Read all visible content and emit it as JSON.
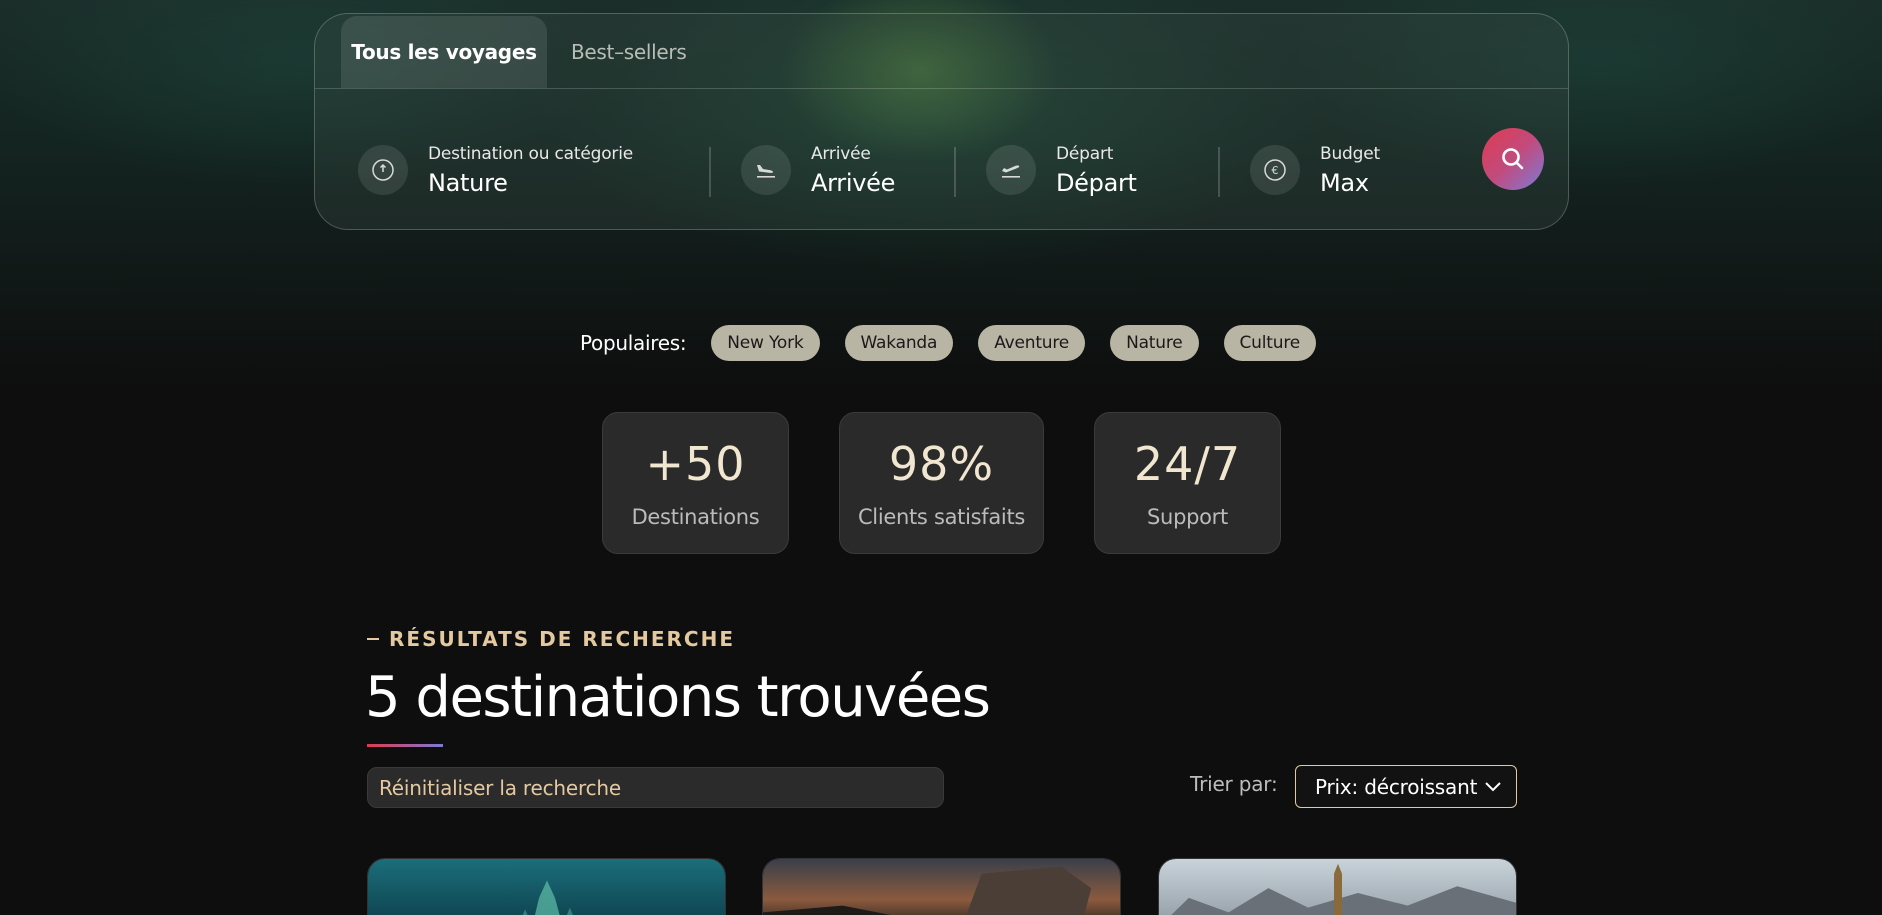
{
  "search": {
    "tabs": [
      {
        "label": "Tous les voyages"
      },
      {
        "label": "Best–sellers"
      }
    ],
    "fields": [
      {
        "label": "Destination ou catégorie",
        "value": "Nature",
        "icon": "compass-icon"
      },
      {
        "label": "Arrivée",
        "value": "Arrivée",
        "icon": "plane-landing-icon"
      },
      {
        "label": "Départ",
        "value": "Départ",
        "icon": "plane-takeoff-icon"
      },
      {
        "label": "Budget",
        "value": "Max",
        "icon": "euro-icon"
      }
    ],
    "search_button_icon": "search-icon"
  },
  "popular": {
    "label": "Populaires:",
    "chips": [
      "New York",
      "Wakanda",
      "Aventure",
      "Nature",
      "Culture"
    ]
  },
  "stats": [
    {
      "value": "+50",
      "label": "Destinations"
    },
    {
      "value": "98%",
      "label": "Clients satisfaits"
    },
    {
      "value": "24/7",
      "label": "Support"
    }
  ],
  "results": {
    "eyebrow": "RÉSULTATS DE RECHERCHE",
    "title": "5 destinations trouvées",
    "reset_label": "Réinitialiser la recherche",
    "sort_label": "Trier par:",
    "sort_value": "Prix: décroissant"
  },
  "colors": {
    "accent_gold": "#e4c9a0",
    "search_gradient_start": "#e03a4e",
    "search_gradient_end": "#7b7bd8",
    "background": "#0e0e0e"
  }
}
